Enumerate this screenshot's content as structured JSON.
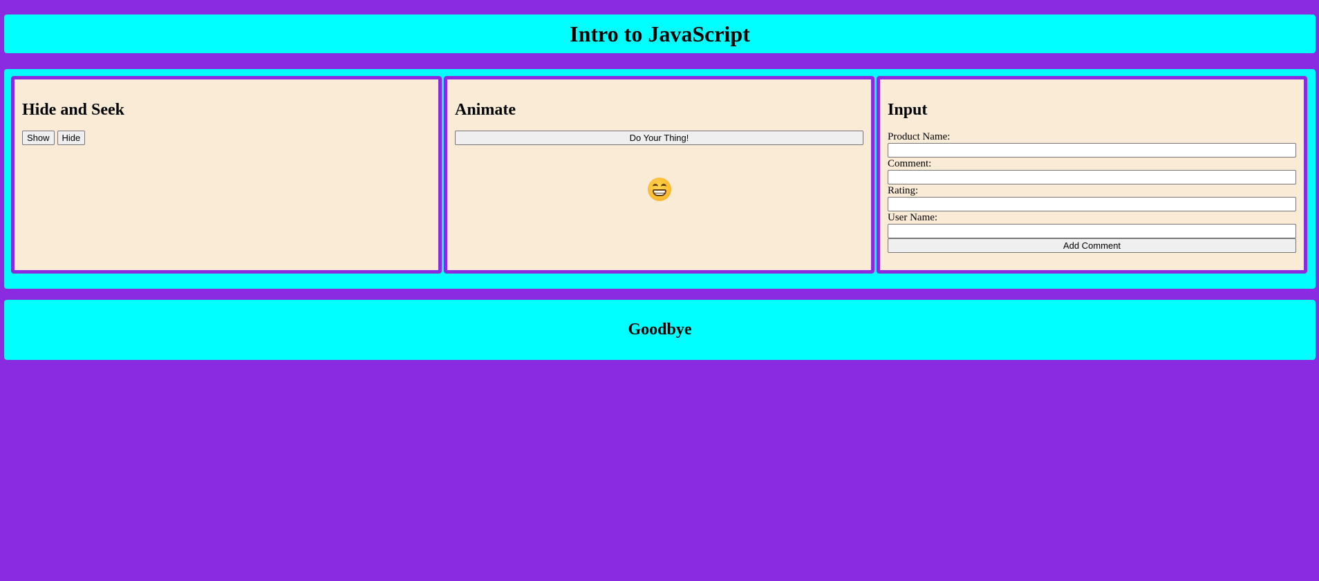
{
  "header": {
    "title": "Intro to JavaScript"
  },
  "hide_and_seek": {
    "title": "Hide and Seek",
    "show_label": "Show",
    "hide_label": "Hide"
  },
  "animate": {
    "title": "Animate",
    "button_label": "Do Your Thing!",
    "emoji_icon": "grinning-face-icon"
  },
  "input": {
    "title": "Input",
    "fields": [
      {
        "label": "Product Name:",
        "value": ""
      },
      {
        "label": "Comment:",
        "value": ""
      },
      {
        "label": "Rating:",
        "value": ""
      },
      {
        "label": "User Name:",
        "value": ""
      }
    ],
    "submit_label": "Add Comment"
  },
  "footer": {
    "title": "Goodbye"
  },
  "colors": {
    "background": "#8a2be2",
    "banner": "#00ffff",
    "panel": "#faebd7"
  }
}
